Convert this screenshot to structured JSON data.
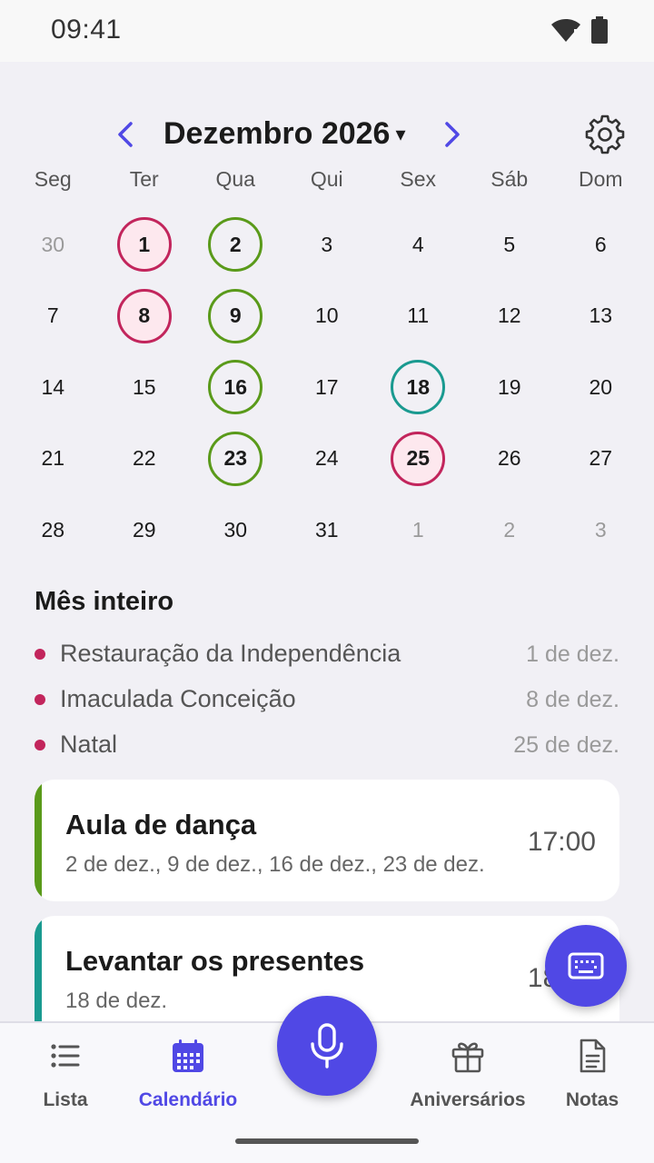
{
  "status_bar": {
    "time": "09:41"
  },
  "header": {
    "month_label": "Dezembro 2026",
    "caret": "▾"
  },
  "weekdays": [
    "Seg",
    "Ter",
    "Qua",
    "Qui",
    "Sex",
    "Sáb",
    "Dom"
  ],
  "calendar": {
    "weeks": [
      [
        {
          "day": "30",
          "muted": true
        },
        {
          "day": "1",
          "mark": "holiday"
        },
        {
          "day": "2",
          "mark": "dance"
        },
        {
          "day": "3"
        },
        {
          "day": "4"
        },
        {
          "day": "5"
        },
        {
          "day": "6"
        }
      ],
      [
        {
          "day": "7"
        },
        {
          "day": "8",
          "mark": "holiday"
        },
        {
          "day": "9",
          "mark": "dance"
        },
        {
          "day": "10"
        },
        {
          "day": "11"
        },
        {
          "day": "12"
        },
        {
          "day": "13"
        }
      ],
      [
        {
          "day": "14"
        },
        {
          "day": "15"
        },
        {
          "day": "16",
          "mark": "dance"
        },
        {
          "day": "17"
        },
        {
          "day": "18",
          "mark": "gift"
        },
        {
          "day": "19"
        },
        {
          "day": "20"
        }
      ],
      [
        {
          "day": "21"
        },
        {
          "day": "22"
        },
        {
          "day": "23",
          "mark": "dance"
        },
        {
          "day": "24"
        },
        {
          "day": "25",
          "mark": "holiday"
        },
        {
          "day": "26"
        },
        {
          "day": "27"
        }
      ],
      [
        {
          "day": "28"
        },
        {
          "day": "29"
        },
        {
          "day": "30"
        },
        {
          "day": "31"
        },
        {
          "day": "1",
          "muted": true
        },
        {
          "day": "2",
          "muted": true
        },
        {
          "day": "3",
          "muted": true
        }
      ]
    ]
  },
  "month_section": {
    "title": "Mês inteiro",
    "holidays": [
      {
        "name": "Restauração da Independência",
        "date": "1 de dez."
      },
      {
        "name": "Imaculada Conceição",
        "date": "8 de dez."
      },
      {
        "name": "Natal",
        "date": "25 de dez."
      }
    ]
  },
  "events": [
    {
      "title": "Aula de dança",
      "dates": "2 de dez., 9 de dez., 16 de dez., 23 de dez.",
      "time": "17:00"
    },
    {
      "title": "Levantar os presentes",
      "dates": "18 de dez.",
      "time": "18:00"
    }
  ],
  "bottom_nav": {
    "lista": "Lista",
    "calendario": "Calendário",
    "aniversarios": "Aniversários",
    "notas": "Notas"
  },
  "colors": {
    "accent": "#5048e5",
    "holiday": "#c2255c",
    "dance": "#5a9a1a",
    "gift": "#1a9a90"
  },
  "icons": {
    "prev": "chevron-left-icon",
    "next": "chevron-right-icon",
    "settings": "gear-icon",
    "keyboard": "keyboard-icon",
    "mic": "microphone-icon",
    "lista": "list-icon",
    "calendario": "calendar-icon",
    "aniversarios": "gift-icon",
    "notas": "document-icon"
  }
}
